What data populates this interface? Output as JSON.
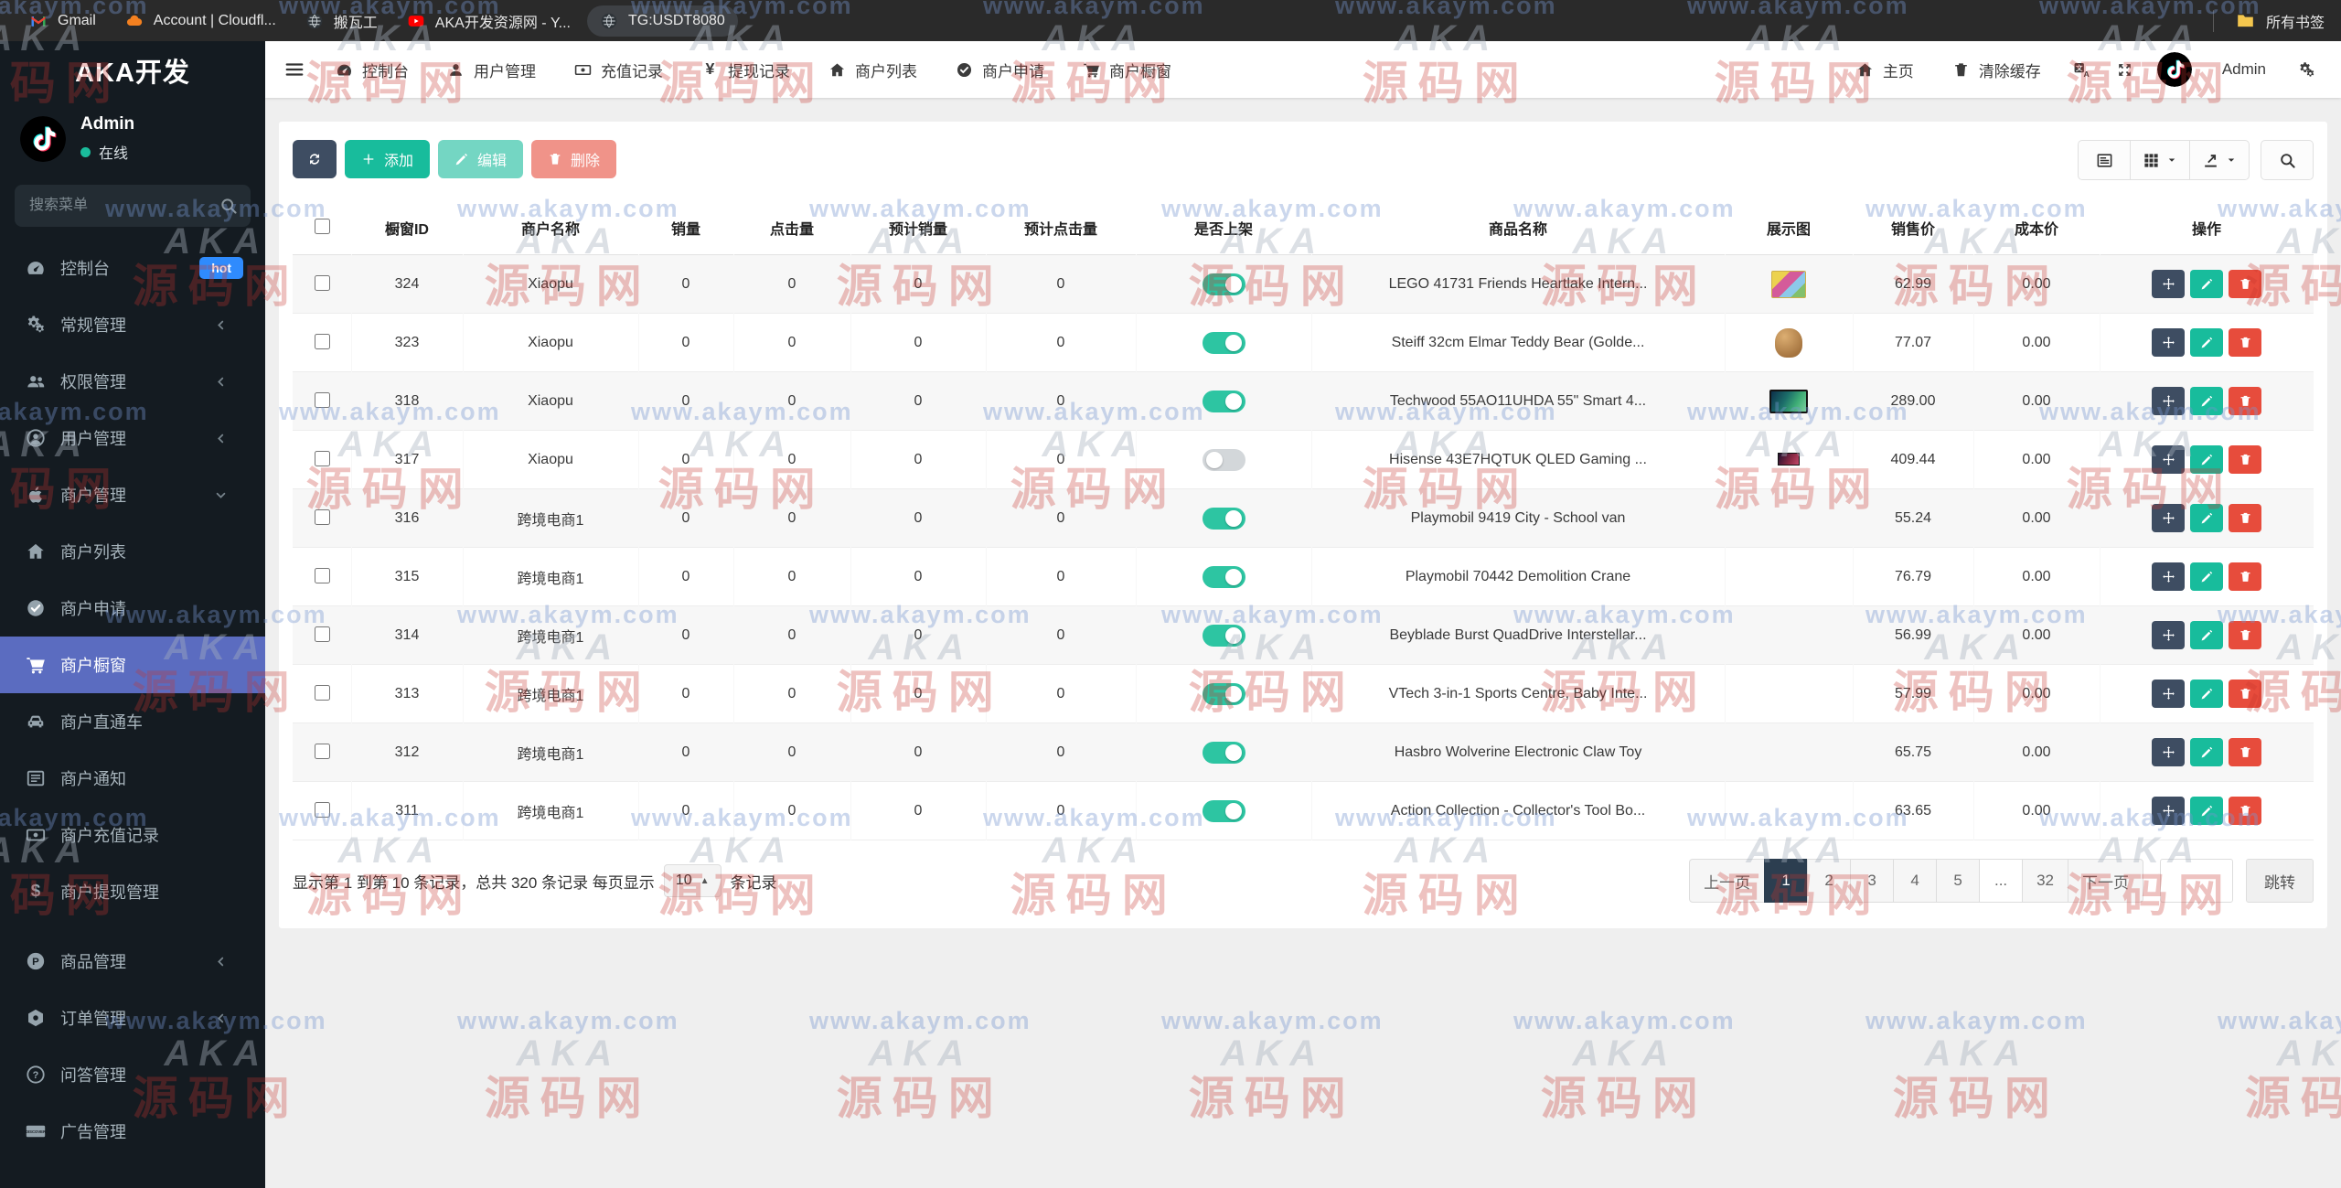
{
  "watermark": {
    "url_text": "www.akaym.com",
    "logo_top": "AKA",
    "logo_bottom": "源码网"
  },
  "bookmarks_bar": {
    "items": [
      {
        "name": "gmail",
        "label": "Gmail",
        "icon": "gmail"
      },
      {
        "name": "cloudflare-account",
        "label": "Account | Cloudfl...",
        "icon": "cloudflare"
      },
      {
        "name": "banwagong",
        "label": "搬瓦工",
        "icon": "globe-dark"
      },
      {
        "name": "aka-dev-site",
        "label": "AKA开发资源网 - Y...",
        "icon": "youtube"
      },
      {
        "name": "tg-usdt",
        "label": "TG:USDT8080",
        "icon": "globe-dark",
        "pill": true
      }
    ],
    "all_bookmarks_label": "所有书签"
  },
  "sidebar": {
    "brand": "AKA开发",
    "user": {
      "name": "Admin",
      "status": "在线"
    },
    "search_placeholder": "搜索菜单",
    "menu": [
      {
        "name": "dashboard",
        "label": "控制台",
        "icon": "tachometer",
        "badge": "hot"
      },
      {
        "name": "general-mgmt",
        "label": "常规管理",
        "icon": "gears2",
        "chevron": "left"
      },
      {
        "name": "permission-mgmt",
        "label": "权限管理",
        "icon": "users",
        "chevron": "left"
      },
      {
        "name": "user-mgmt",
        "label": "用户管理",
        "icon": "user-circle",
        "chevron": "left"
      },
      {
        "name": "merchant-mgmt",
        "label": "商户管理",
        "icon": "apple",
        "chevron": "down",
        "children": [
          {
            "name": "merchant-list",
            "label": "商户列表",
            "icon": "home"
          },
          {
            "name": "merchant-apply",
            "label": "商户申请",
            "icon": "check-circle"
          },
          {
            "name": "merchant-showcase",
            "label": "商户橱窗",
            "icon": "cart",
            "active": true
          },
          {
            "name": "merchant-express",
            "label": "商户直通车",
            "icon": "car"
          },
          {
            "name": "merchant-notice",
            "label": "商户通知",
            "icon": "memo"
          },
          {
            "name": "merchant-recharge",
            "label": "商户充值记录",
            "icon": "money"
          },
          {
            "name": "merchant-withdraw",
            "label": "商户提现管理",
            "icon": "dollar"
          }
        ]
      },
      {
        "name": "product-mgmt",
        "label": "商品管理",
        "icon": "p-circle",
        "chevron": "left"
      },
      {
        "name": "order-mgmt",
        "label": "订单管理",
        "icon": "order",
        "chevron": "left"
      },
      {
        "name": "qa-mgmt",
        "label": "问答管理",
        "icon": "question-circle"
      },
      {
        "name": "ad-mgmt",
        "label": "广告管理",
        "icon": "discover"
      }
    ]
  },
  "topnav": {
    "left": [
      {
        "name": "dashboard",
        "label": "控制台",
        "icon": "tachometer"
      },
      {
        "name": "user-mgmt",
        "label": "用户管理",
        "icon": "user"
      },
      {
        "name": "recharge-records",
        "label": "充值记录",
        "icon": "money"
      },
      {
        "name": "withdraw-records",
        "label": "提现记录",
        "icon": "yen"
      },
      {
        "name": "merchant-list",
        "label": "商户列表",
        "icon": "home"
      },
      {
        "name": "merchant-apply",
        "label": "商户申请",
        "icon": "check-circle"
      },
      {
        "name": "merchant-showcase",
        "label": "商户橱窗",
        "icon": "cart"
      }
    ],
    "right": [
      {
        "name": "home-page",
        "label": "主页",
        "icon": "home"
      },
      {
        "name": "clear-cache",
        "label": "清除缓存",
        "icon": "trash"
      },
      {
        "name": "language",
        "icon": "translate"
      },
      {
        "name": "fullscreen",
        "icon": "expand"
      },
      {
        "name": "avatar",
        "avatar": true,
        "icon": "tiktok"
      },
      {
        "name": "admin-user",
        "label": "Admin"
      },
      {
        "name": "settings",
        "icon": "gears2"
      }
    ]
  },
  "toolbar": {
    "left": [
      {
        "name": "refresh",
        "icon": "refresh",
        "label": "",
        "style": "navy"
      },
      {
        "name": "add",
        "icon": "plus",
        "label": "添加",
        "style": "teal"
      },
      {
        "name": "edit",
        "icon": "pencil",
        "label": "编辑",
        "style": "teal",
        "disabled": true
      },
      {
        "name": "delete",
        "icon": "trash",
        "label": "删除",
        "style": "red",
        "disabled": true
      }
    ],
    "right": [
      {
        "name": "detail-view",
        "icon": "list-detail"
      },
      {
        "name": "columns",
        "icon": "grid",
        "caret": true
      },
      {
        "name": "export",
        "icon": "export",
        "caret": true
      },
      {
        "name": "search",
        "icon": "search"
      }
    ]
  },
  "table": {
    "headers": [
      "橱窗ID",
      "商户名称",
      "销量",
      "点击量",
      "预计销量",
      "预计点击量",
      "是否上架",
      "商品名称",
      "展示图",
      "销售价",
      "成本价",
      "操作"
    ],
    "rows": [
      {
        "id": "324",
        "merchant": "Xiaopu",
        "sales": "0",
        "clicks": "0",
        "est_sales": "0",
        "est_clicks": "0",
        "on": true,
        "product": "LEGO 41731 Friends Heartlake Intern...",
        "thumb": "lego",
        "price": "62.99",
        "cost": "0.00"
      },
      {
        "id": "323",
        "merchant": "Xiaopu",
        "sales": "0",
        "clicks": "0",
        "est_sales": "0",
        "est_clicks": "0",
        "on": true,
        "product": "Steiff 32cm Elmar Teddy Bear (Golde...",
        "thumb": "teddy",
        "price": "77.07",
        "cost": "0.00"
      },
      {
        "id": "318",
        "merchant": "Xiaopu",
        "sales": "0",
        "clicks": "0",
        "est_sales": "0",
        "est_clicks": "0",
        "on": true,
        "product": "Techwood 55AO11UHDA 55\" Smart 4...",
        "thumb": "tv",
        "price": "289.00",
        "cost": "0.00"
      },
      {
        "id": "317",
        "merchant": "Xiaopu",
        "sales": "0",
        "clicks": "0",
        "est_sales": "0",
        "est_clicks": "0",
        "on": false,
        "product": "Hisense 43E7HQTUK QLED Gaming ...",
        "thumb": "tv-sm",
        "price": "409.44",
        "cost": "0.00"
      },
      {
        "id": "316",
        "merchant": "跨境电商1",
        "sales": "0",
        "clicks": "0",
        "est_sales": "0",
        "est_clicks": "0",
        "on": true,
        "product": "Playmobil 9419 City - School van",
        "thumb": "",
        "price": "55.24",
        "cost": "0.00"
      },
      {
        "id": "315",
        "merchant": "跨境电商1",
        "sales": "0",
        "clicks": "0",
        "est_sales": "0",
        "est_clicks": "0",
        "on": true,
        "product": "Playmobil 70442 Demolition Crane",
        "thumb": "",
        "price": "76.79",
        "cost": "0.00"
      },
      {
        "id": "314",
        "merchant": "跨境电商1",
        "sales": "0",
        "clicks": "0",
        "est_sales": "0",
        "est_clicks": "0",
        "on": true,
        "product": "Beyblade Burst QuadDrive Interstellar...",
        "thumb": "",
        "price": "56.99",
        "cost": "0.00"
      },
      {
        "id": "313",
        "merchant": "跨境电商1",
        "sales": "0",
        "clicks": "0",
        "est_sales": "0",
        "est_clicks": "0",
        "on": true,
        "product": "VTech 3-in-1 Sports Centre, Baby Inte...",
        "thumb": "",
        "price": "57.99",
        "cost": "0.00"
      },
      {
        "id": "312",
        "merchant": "跨境电商1",
        "sales": "0",
        "clicks": "0",
        "est_sales": "0",
        "est_clicks": "0",
        "on": true,
        "product": "Hasbro Wolverine Electronic Claw Toy",
        "thumb": "",
        "price": "65.75",
        "cost": "0.00"
      },
      {
        "id": "311",
        "merchant": "跨境电商1",
        "sales": "0",
        "clicks": "0",
        "est_sales": "0",
        "est_clicks": "0",
        "on": true,
        "product": "Action Collection - Collector's Tool Bo...",
        "thumb": "",
        "price": "63.65",
        "cost": "0.00"
      }
    ]
  },
  "footer": {
    "info_prefix": "显示第 1 到第 10 条记录，总共 320 条记录 每页显示",
    "per_page": "10",
    "info_suffix": "条记录"
  },
  "pagination": {
    "prev": "上一页",
    "next": "下一页",
    "pages": [
      "1",
      "2",
      "3",
      "4",
      "5",
      "...",
      "32"
    ],
    "active": "1",
    "jump_label": "跳转"
  },
  "colors": {
    "sidebar_active": "#5b6cc0",
    "teal": "#18bc9c",
    "red": "#e74c3c",
    "navy": "#3e4d62",
    "pagination_active": "#2c3e50",
    "toggle_on": "#2dc5a2",
    "hot_badge": "#2f8bfd"
  }
}
